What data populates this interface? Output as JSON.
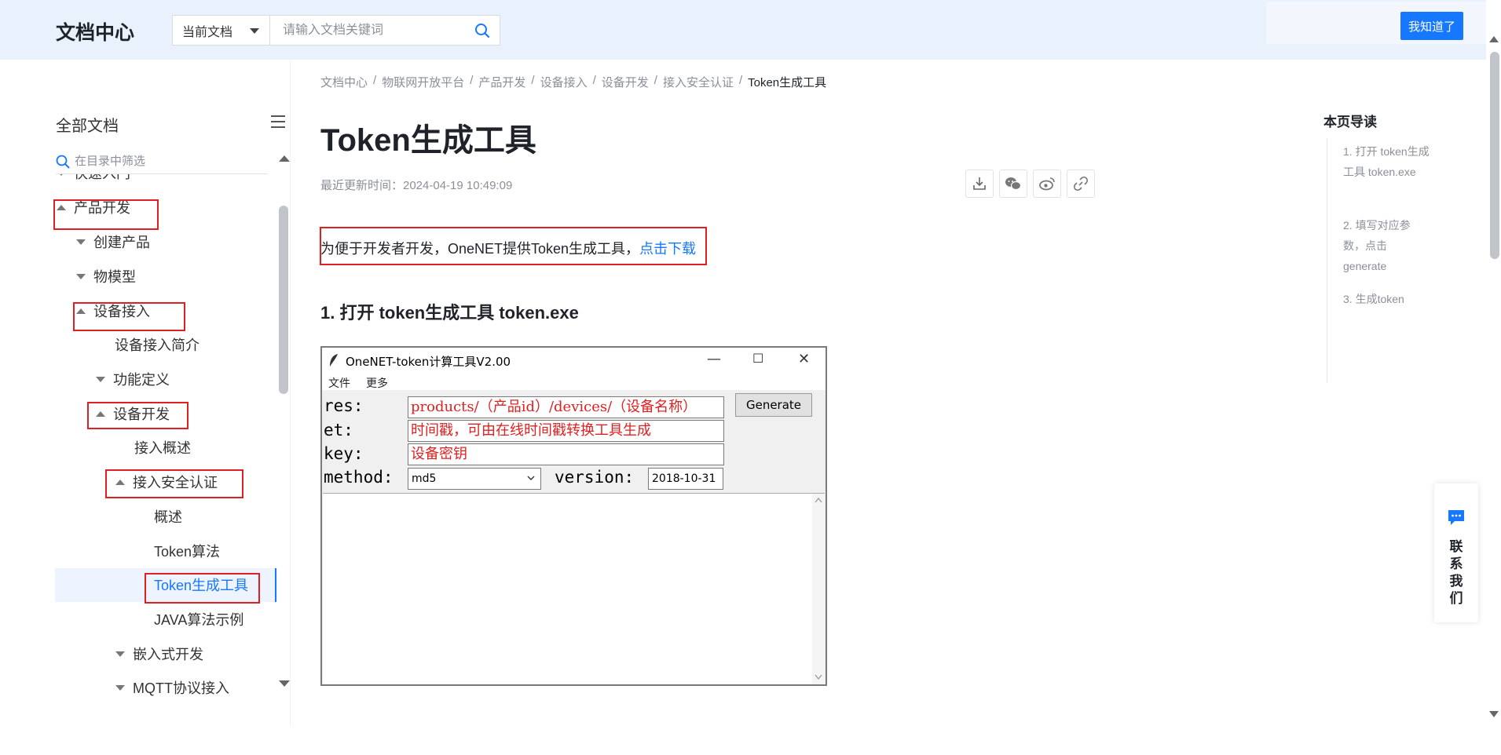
{
  "header": {
    "logo": "文档中心",
    "scope": "当前文档",
    "search_placeholder": "请输入文档关键词",
    "got_it": "我知道了"
  },
  "sidebar": {
    "title": "全部文档",
    "filter_placeholder": "在目录中筛选",
    "items": [
      {
        "label": "快速入门",
        "level": 0,
        "expanded": true
      },
      {
        "label": "产品开发",
        "level": 0,
        "expanded": true
      },
      {
        "label": "创建产品",
        "level": 1,
        "expanded": false
      },
      {
        "label": "物模型",
        "level": 1,
        "expanded": false
      },
      {
        "label": "设备接入",
        "level": 1,
        "expanded": true
      },
      {
        "label": "设备接入简介",
        "level": 2
      },
      {
        "label": "功能定义",
        "level": 2,
        "expanded": false
      },
      {
        "label": "设备开发",
        "level": 2,
        "expanded": true
      },
      {
        "label": "接入概述",
        "level": 3
      },
      {
        "label": "接入安全认证",
        "level": 3,
        "expanded": true
      },
      {
        "label": "概述",
        "level": 4
      },
      {
        "label": "Token算法",
        "level": 4
      },
      {
        "label": "Token生成工具",
        "level": 4,
        "active": true
      },
      {
        "label": "JAVA算法示例",
        "level": 4
      },
      {
        "label": "嵌入式开发",
        "level": 3,
        "expanded": false
      },
      {
        "label": "MQTT协议接入",
        "level": 3,
        "expanded": false
      }
    ]
  },
  "breadcrumb": [
    "文档中心",
    "物联网开放平台",
    "产品开发",
    "设备接入",
    "设备开发",
    "接入安全认证",
    "Token生成工具"
  ],
  "article": {
    "title": "Token生成工具",
    "updated": "最近更新时间：2024-04-19 10:49:09",
    "intro": "为便于开发者开发，OneNET提供Token生成工具，",
    "intro_link": "点击下载",
    "section1": "1. 打开 token生成工具 token.exe"
  },
  "tool_window": {
    "title": "OneNET-token计算工具V2.00",
    "menu_file": "文件",
    "menu_more": "更多",
    "res_label": "res:",
    "res_value": "products/（产品id）/devices/（设备名称）",
    "et_label": "et:",
    "et_value": "时间戳，可由在线时间戳转换工具生成",
    "key_label": "key:",
    "key_value": "设备密钥",
    "method_label": "method:",
    "method_value": "md5",
    "version_label": "version:",
    "version_value": "2018-10-31",
    "generate": "Generate"
  },
  "toc": {
    "title": "本页导读",
    "items": [
      "1. 打开 token生成工具 token.exe",
      "2. 填写对应参数，点击generate",
      "3. 生成token"
    ]
  },
  "contact": "联系我们",
  "colors": {
    "accent": "#1677ff",
    "highlight": "#e02020",
    "header_bg": "#e8f1fc"
  }
}
